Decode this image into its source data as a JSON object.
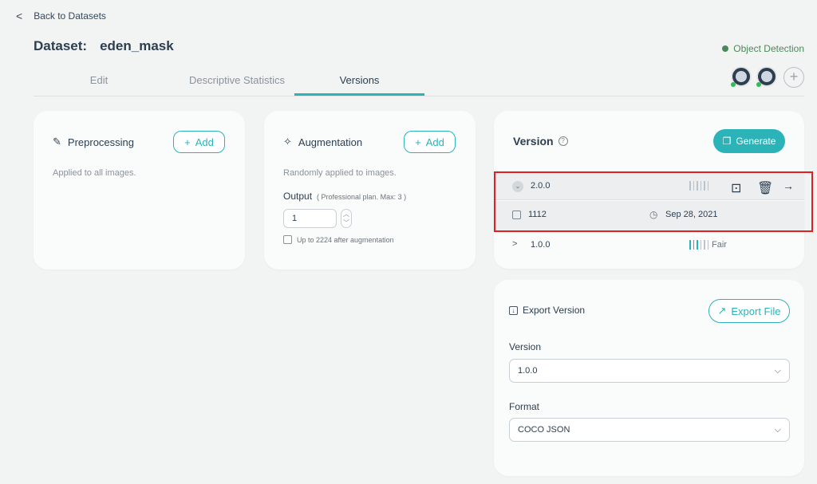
{
  "nav": {
    "back_label": "Back to Datasets"
  },
  "header": {
    "dataset_prefix": "Dataset:",
    "dataset_name": "eden_mask",
    "project_type": "Object Detection"
  },
  "tabs": [
    {
      "label": "Edit"
    },
    {
      "label": "Descriptive Statistics"
    },
    {
      "label": "Versions",
      "active": true
    }
  ],
  "preprocessing": {
    "title": "Preprocessing",
    "add_label": "Add",
    "description": "Applied to all images."
  },
  "augmentation": {
    "title": "Augmentation",
    "add_label": "Add",
    "description": "Randomly applied to images.",
    "output_label": "Output",
    "plan_note": "( Professional plan. Max: 3 )",
    "output_value": "1",
    "after_note": "Up to 2224 after augmentation"
  },
  "version_panel": {
    "title": "Version",
    "generate_label": "Generate",
    "versions": [
      {
        "name": "2.0.0",
        "expanded": true,
        "image_count": "1112",
        "date": "Sep 28, 2021",
        "health_label": ""
      },
      {
        "name": "1.0.0",
        "expanded": false,
        "health_label": "Fair"
      }
    ]
  },
  "export": {
    "title": "Export Version",
    "export_label": "Export File",
    "version_field_label": "Version",
    "version_value": "1.0.0",
    "format_field_label": "Format",
    "format_value": "COCO JSON"
  },
  "colors": {
    "accent": "#2bb3b8",
    "highlight_border": "#e02020",
    "status_green": "#4a8a5a"
  },
  "icons": {
    "back": "chevron-left-icon",
    "preprocess": "brush-icon",
    "augment": "sparkle-icon",
    "help": "question-circle-icon",
    "generate": "copy-icon",
    "duplicate": "duplicate-icon",
    "delete": "trash-icon",
    "open": "arrow-right-icon",
    "images": "image-icon",
    "date": "clock-icon",
    "export_file": "export-icon"
  }
}
